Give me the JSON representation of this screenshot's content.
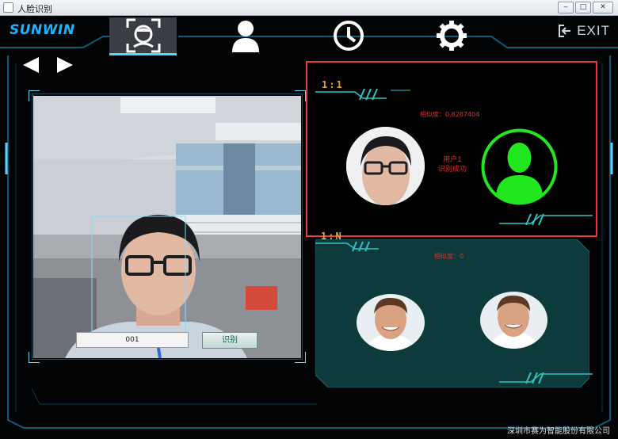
{
  "window": {
    "title": "人脸识别",
    "min": "‒",
    "max": "□",
    "close": "✕"
  },
  "header": {
    "logo": "SUNWIN",
    "nav": [
      {
        "icon": "face-scan-icon",
        "active": true
      },
      {
        "icon": "user-icon",
        "active": false
      },
      {
        "icon": "clock-icon",
        "active": false
      },
      {
        "icon": "gear-icon",
        "active": false
      }
    ],
    "exit_label": "EXIT"
  },
  "camera": {
    "id_value": "001",
    "recognize_button": "识别"
  },
  "one_to_one": {
    "label": "1:1",
    "similarity": "相似度：0.8287404",
    "user": "用户1",
    "status": "识别成功"
  },
  "one_to_n": {
    "label": "1:N",
    "similarity": "相似度：0"
  },
  "footer": {
    "company": "深圳市赛为智能股份有限公司"
  },
  "colors": {
    "accent": "#19b5ff",
    "alert": "#e62b2b",
    "match": "#22e61e",
    "panel_teal": "#0d3b3b"
  }
}
